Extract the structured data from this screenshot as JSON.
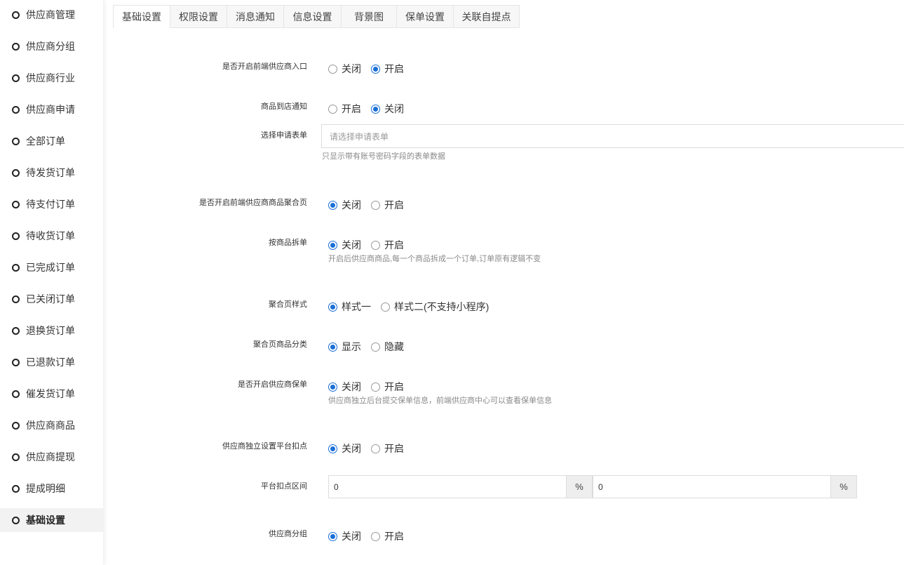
{
  "sidebar": {
    "items": [
      {
        "label": "供应商管理"
      },
      {
        "label": "供应商分组"
      },
      {
        "label": "供应商行业"
      },
      {
        "label": "供应商申请"
      },
      {
        "label": "全部订单"
      },
      {
        "label": "待发货订单"
      },
      {
        "label": "待支付订单"
      },
      {
        "label": "待收货订单"
      },
      {
        "label": "已完成订单"
      },
      {
        "label": "已关闭订单"
      },
      {
        "label": "退换货订单"
      },
      {
        "label": "已退款订单"
      },
      {
        "label": "催发货订单"
      },
      {
        "label": "供应商商品"
      },
      {
        "label": "供应商提现"
      },
      {
        "label": "提成明细"
      },
      {
        "label": "基础设置"
      }
    ],
    "active_index": 16
  },
  "tabs": [
    {
      "label": "基础设置"
    },
    {
      "label": "权限设置"
    },
    {
      "label": "消息通知"
    },
    {
      "label": "信息设置"
    },
    {
      "label": "背景图"
    },
    {
      "label": "保单设置"
    },
    {
      "label": "关联自提点"
    }
  ],
  "form": {
    "entry": {
      "label": "是否开启前端供应商入口",
      "opt1": "关闭",
      "opt2": "开启",
      "selected": 2
    },
    "arrival": {
      "label": "商品到店通知",
      "opt1": "开启",
      "opt2": "关闭",
      "selected": 2
    },
    "apply_form": {
      "label": "选择申请表单",
      "placeholder": "请选择申请表单",
      "help": "只显示带有账号密码字段的表单数据"
    },
    "aggregate": {
      "label": "是否开启前端供应商商品聚合页",
      "opt1": "关闭",
      "opt2": "开启",
      "selected": 1
    },
    "split": {
      "label": "按商品拆单",
      "opt1": "关闭",
      "opt2": "开启",
      "selected": 1,
      "help": "开启后供应商商品,每一个商品拆成一个订单,订单原有逻辑不变"
    },
    "agg_style": {
      "label": "聚合页样式",
      "opt1": "样式一",
      "opt2": "样式二(不支持小程序)",
      "selected": 1
    },
    "agg_category": {
      "label": "聚合页商品分类",
      "opt1": "显示",
      "opt2": "隐藏",
      "selected": 1
    },
    "policy": {
      "label": "是否开启供应商保单",
      "opt1": "关闭",
      "opt2": "开启",
      "selected": 1,
      "help": "供应商独立后台提交保单信息，前端供应商中心可以查看保单信息"
    },
    "deduct": {
      "label": "供应商独立设置平台扣点",
      "opt1": "关闭",
      "opt2": "开启",
      "selected": 1
    },
    "deduct_range": {
      "label": "平台扣点区间",
      "min": "0",
      "max": "0",
      "unit": "%"
    },
    "grouping": {
      "label": "供应商分组",
      "opt1": "关闭",
      "opt2": "开启",
      "selected": 1
    }
  },
  "colors": {
    "accent": "#1a6fd6"
  }
}
